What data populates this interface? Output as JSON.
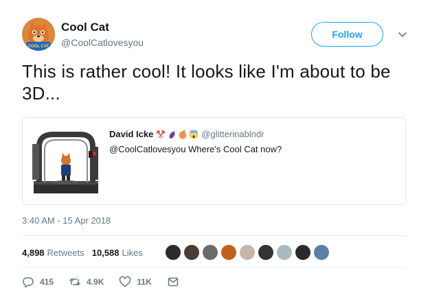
{
  "author": {
    "display_name": "Cool Cat",
    "handle": "@CoolCatlovesyou",
    "avatar_icon": "cool-cat-mascot-avatar",
    "avatar_text": "COOL CAT"
  },
  "follow_button": {
    "label": "Follow"
  },
  "tweet": {
    "text": "This is rather cool!  It looks like I'm about to be 3D..."
  },
  "quoted_tweet": {
    "media_icon": "3d-scanner-rig-photo",
    "display_name": "David Icke",
    "emojis": [
      "clown-face",
      "eggplant",
      "peach",
      "screaming-face"
    ],
    "handle": "@glitterinablndr",
    "text": "@CoolCatlovesyou Where's Cool Cat now?"
  },
  "timestamp": "3:40 AM - 15 Apr 2018",
  "stats": {
    "retweets_count": "4,898",
    "retweets_label": "Retweets",
    "likes_count": "10,588",
    "likes_label": "Likes"
  },
  "likers": [
    {
      "color": "#2b2b2b"
    },
    {
      "color": "#4a3b36"
    },
    {
      "color": "#6b6b6b"
    },
    {
      "color": "#c0611f"
    },
    {
      "color": "#c7b5a8"
    },
    {
      "color": "#333333"
    },
    {
      "color": "#aab8c2"
    },
    {
      "color": "#2a2a2a"
    },
    {
      "color": "#5b7fa6"
    }
  ],
  "actions": {
    "reply_count": "415",
    "retweet_count": "4.9K",
    "like_count": "11K"
  },
  "colors": {
    "accent": "#1da1f2",
    "secondary_text": "#657786",
    "divider": "#e6ecf0"
  }
}
